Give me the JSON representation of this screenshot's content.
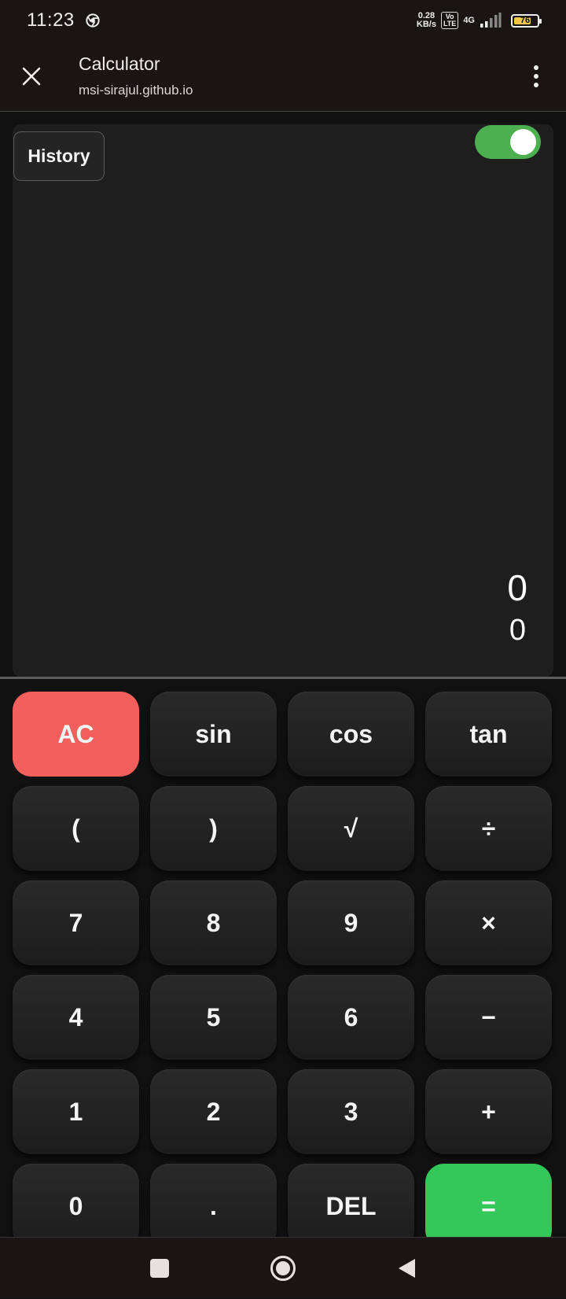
{
  "status_bar": {
    "time": "11:23",
    "net_speed_value": "0.28",
    "net_speed_unit": "KB/s",
    "volte_top": "Vo",
    "volte_bottom": "LTE",
    "network": "4G",
    "battery_level": "76",
    "battery_fraction": 0.76,
    "battery_color": "#f6c84a"
  },
  "header": {
    "title": "Calculator",
    "url": "msi-sirajul.github.io",
    "close_icon": "close-icon",
    "menu_icon": "more-vertical-icon"
  },
  "display": {
    "history_label": "History",
    "toggle_on": true,
    "toggle_color": "#4caf50",
    "expression": "0",
    "result": "0"
  },
  "keys": [
    "AC",
    "sin",
    "cos",
    "tan",
    "(",
    ")",
    "√",
    "÷",
    "7",
    "8",
    "9",
    "×",
    "4",
    "5",
    "6",
    "−",
    "1",
    "2",
    "3",
    "+",
    "0",
    ".",
    "DEL",
    "="
  ],
  "colors": {
    "ac": "#f25f5c",
    "equals": "#34c759"
  },
  "nav_bar": {
    "recents_icon": "square-icon",
    "home_icon": "home-circle-icon",
    "back_icon": "back-triangle-icon"
  }
}
